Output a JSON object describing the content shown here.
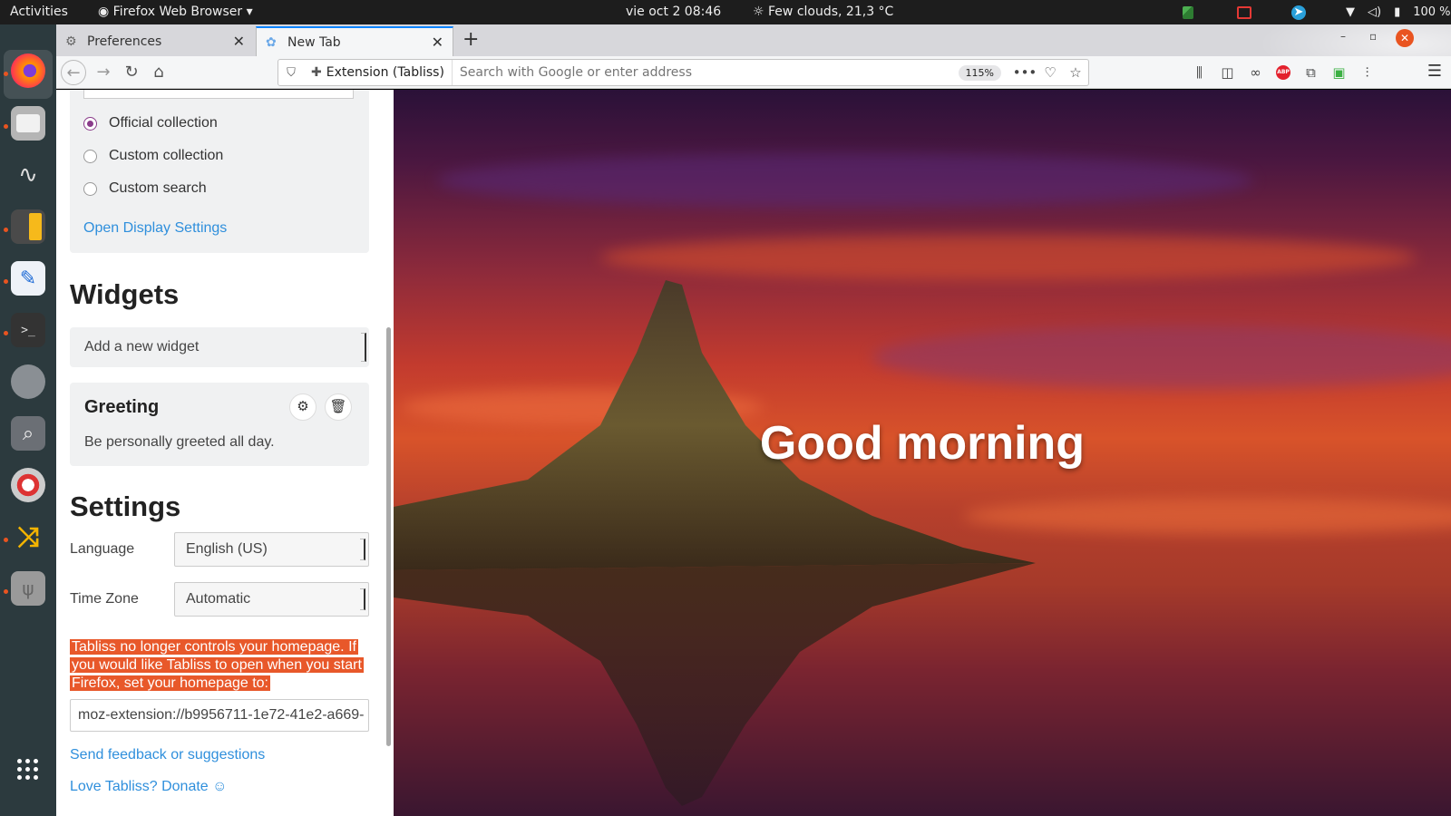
{
  "topbar": {
    "activities": "Activities",
    "app_name": "Firefox Web Browser",
    "clock": "vie oct 2  08:46",
    "weather": "Few clouds, 21,3 °C",
    "battery": "100 %"
  },
  "dock": {
    "apps": [
      "firefox-icon",
      "files-icon",
      "system-monitor-icon",
      "calculator-icon",
      "text-editor-icon",
      "terminal-icon",
      "disks-icon",
      "search-icon",
      "help-icon",
      "app-icon",
      "usb-icon",
      "show-applications-icon"
    ]
  },
  "tabs": [
    {
      "label": "Preferences",
      "icon": "gear-icon"
    },
    {
      "label": "New Tab",
      "icon": "tabliss-icon"
    }
  ],
  "navbar": {
    "extension_label": "Extension (Tabliss)",
    "url_placeholder": "Search with Google or enter address",
    "zoom": "115%"
  },
  "panel": {
    "radios": [
      {
        "label": "Official collection",
        "checked": true
      },
      {
        "label": "Custom collection",
        "checked": false
      },
      {
        "label": "Custom search",
        "checked": false
      }
    ],
    "open_display_settings": "Open Display Settings",
    "widgets_heading": "Widgets",
    "add_widget_placeholder": "Add a new widget",
    "greeting_widget": {
      "title": "Greeting",
      "description": "Be personally greeted all day."
    },
    "settings_heading": "Settings",
    "language_label": "Language",
    "language_value": "English (US)",
    "timezone_label": "Time Zone",
    "timezone_value": "Automatic",
    "homepage_warning": "Tabliss no longer controls your homepage. If you would like Tabliss to open when you start Firefox, set your homepage to:",
    "homepage_url": "moz-extension://b9956711-1e72-41e2-a669-",
    "feedback_link": "Send feedback or suggestions",
    "donate_link": "Love Tabliss? Donate ☺"
  },
  "greeting_text": "Good morning",
  "colors": {
    "accent": "#2f8fdc",
    "warning": "#e8582a",
    "radio": "#8a3b8a"
  }
}
